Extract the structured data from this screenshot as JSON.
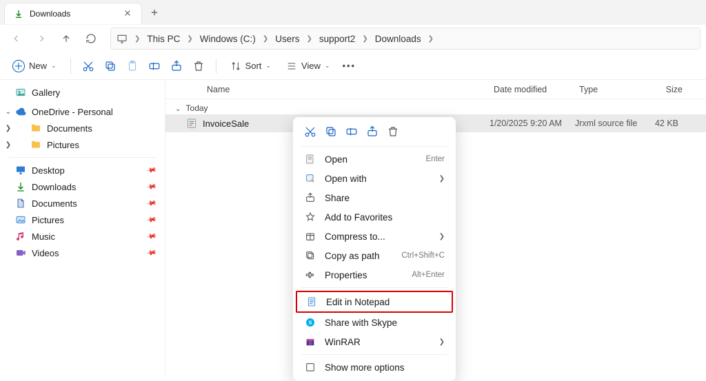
{
  "tab": {
    "title": "Downloads"
  },
  "breadcrumbs": [
    "This PC",
    "Windows (C:)",
    "Users",
    "support2",
    "Downloads"
  ],
  "toolbar": {
    "new": "New",
    "sort": "Sort",
    "view": "View"
  },
  "columns": {
    "name": "Name",
    "date": "Date modified",
    "type": "Type",
    "size": "Size"
  },
  "group_today": "Today",
  "file": {
    "name": "InvoiceSale",
    "date": "1/20/2025 9:20 AM",
    "type": "Jrxml source file",
    "size": "42 KB"
  },
  "sidebar": {
    "gallery": "Gallery",
    "onedrive": "OneDrive - Personal",
    "documents": "Documents",
    "pictures": "Pictures",
    "desktop": "Desktop",
    "downloads": "Downloads",
    "music": "Music",
    "videos": "Videos"
  },
  "ctx": {
    "open": "Open",
    "open_sc": "Enter",
    "openwith": "Open with",
    "share": "Share",
    "fav": "Add to Favorites",
    "compress": "Compress to...",
    "copypath": "Copy as path",
    "copypath_sc": "Ctrl+Shift+C",
    "props": "Properties",
    "props_sc": "Alt+Enter",
    "notepad": "Edit in Notepad",
    "skype": "Share with Skype",
    "winrar": "WinRAR",
    "more": "Show more options"
  }
}
